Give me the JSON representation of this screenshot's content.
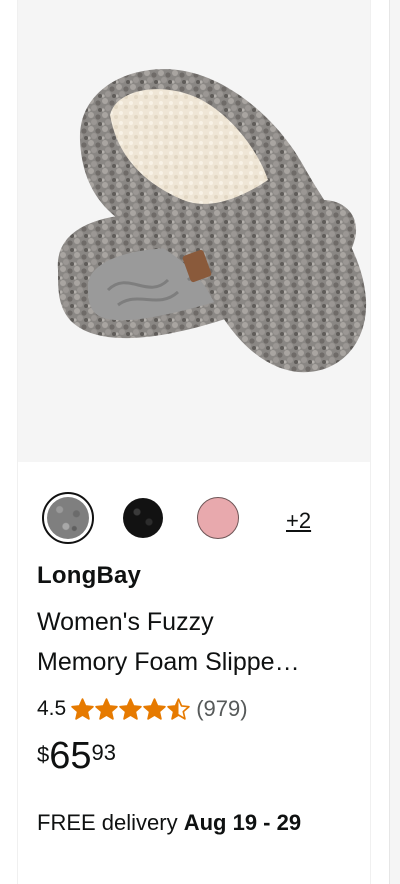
{
  "product": {
    "image_alt": "Gray fuzzy slippers",
    "swatches": [
      {
        "name": "gray",
        "color": "#7f7f7f",
        "selected": true
      },
      {
        "name": "black",
        "color": "#121212",
        "selected": false
      },
      {
        "name": "pink",
        "color": "#e8a9ad",
        "selected": false
      }
    ],
    "more_swatches_label": "+2",
    "brand": "LongBay",
    "title_line_1": "Women's Fuzzy",
    "title_line_2": "Memory Foam Slippe…",
    "rating_value": "4.5",
    "rating_stars": 4.5,
    "review_count": "(979)",
    "price_symbol": "$",
    "price_whole": "65",
    "price_fraction": "93",
    "delivery_label": "FREE delivery ",
    "delivery_date": "Aug 19 - 29"
  },
  "colors": {
    "star": "#e67a00",
    "image_background": "#f5f5f5"
  }
}
